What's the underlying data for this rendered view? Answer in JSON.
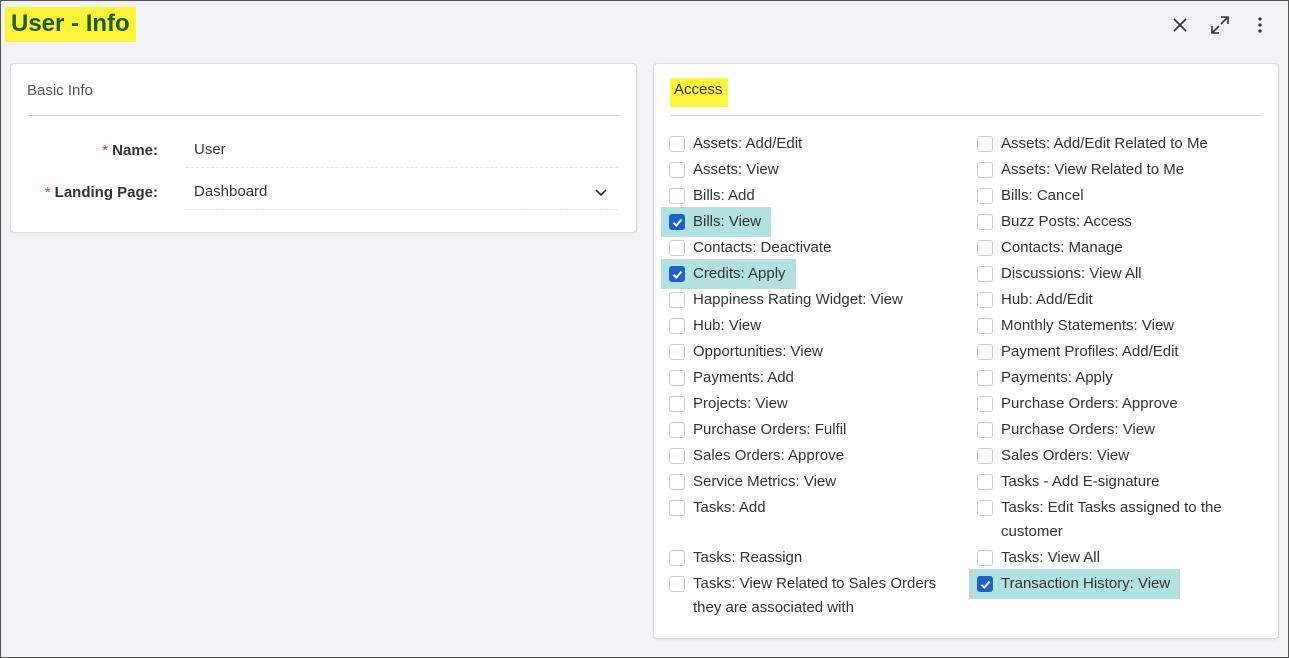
{
  "header": {
    "title": "User - Info"
  },
  "basic_info": {
    "title": "Basic Info",
    "name_label": "Name:",
    "name_value": "User",
    "landing_label": "Landing Page:",
    "landing_value": "Dashboard",
    "required_mark": "*"
  },
  "access": {
    "title": "Access",
    "left": [
      {
        "label": "Assets: Add/Edit",
        "checked": false
      },
      {
        "label": "Assets: View",
        "checked": false
      },
      {
        "label": "Bills: Add",
        "checked": false
      },
      {
        "label": "Bills: View",
        "checked": true
      },
      {
        "label": "Contacts: Deactivate",
        "checked": false
      },
      {
        "label": "Credits: Apply",
        "checked": true
      },
      {
        "label": "Happiness Rating Widget: View",
        "checked": false
      },
      {
        "label": "Hub: View",
        "checked": false
      },
      {
        "label": "Opportunities: View",
        "checked": false
      },
      {
        "label": "Payments: Add",
        "checked": false
      },
      {
        "label": "Projects: View",
        "checked": false
      },
      {
        "label": "Purchase Orders: Fulfil",
        "checked": false
      },
      {
        "label": "Sales Orders: Approve",
        "checked": false
      },
      {
        "label": "Service Metrics: View",
        "checked": false
      },
      {
        "label": "Tasks: Add",
        "checked": false
      },
      {
        "label": "Tasks: Reassign",
        "checked": false
      },
      {
        "label": "Tasks: View Related to Sales Orders they are associated with",
        "checked": false
      }
    ],
    "right": [
      {
        "label": "Assets: Add/Edit Related to Me",
        "checked": false
      },
      {
        "label": "Assets: View Related to Me",
        "checked": false
      },
      {
        "label": "Bills: Cancel",
        "checked": false
      },
      {
        "label": "Buzz Posts: Access",
        "checked": false
      },
      {
        "label": "Contacts: Manage",
        "checked": false
      },
      {
        "label": "Discussions: View All",
        "checked": false
      },
      {
        "label": "Hub: Add/Edit",
        "checked": false
      },
      {
        "label": "Monthly Statements: View",
        "checked": false
      },
      {
        "label": "Payment Profiles: Add/Edit",
        "checked": false
      },
      {
        "label": "Payments: Apply",
        "checked": false
      },
      {
        "label": "Purchase Orders: Approve",
        "checked": false
      },
      {
        "label": "Purchase Orders: View",
        "checked": false
      },
      {
        "label": "Sales Orders: View",
        "checked": false
      },
      {
        "label": "Tasks - Add E-signature",
        "checked": false
      },
      {
        "label": "Tasks: Edit Tasks assigned to the customer",
        "checked": false
      },
      {
        "label": "Tasks: View All",
        "checked": false
      },
      {
        "label": "Transaction History: View",
        "checked": true
      }
    ]
  },
  "icons": [
    "close-icon",
    "expand-icon",
    "more-vertical-icon",
    "chevron-down-icon",
    "checkmark-icon"
  ],
  "colors": {
    "highlight_yellow": "#fdf53a",
    "title_green": "#1b5e2e",
    "checked_bg": "#b1e2e0",
    "checkbox_blue": "#1c63c9"
  }
}
